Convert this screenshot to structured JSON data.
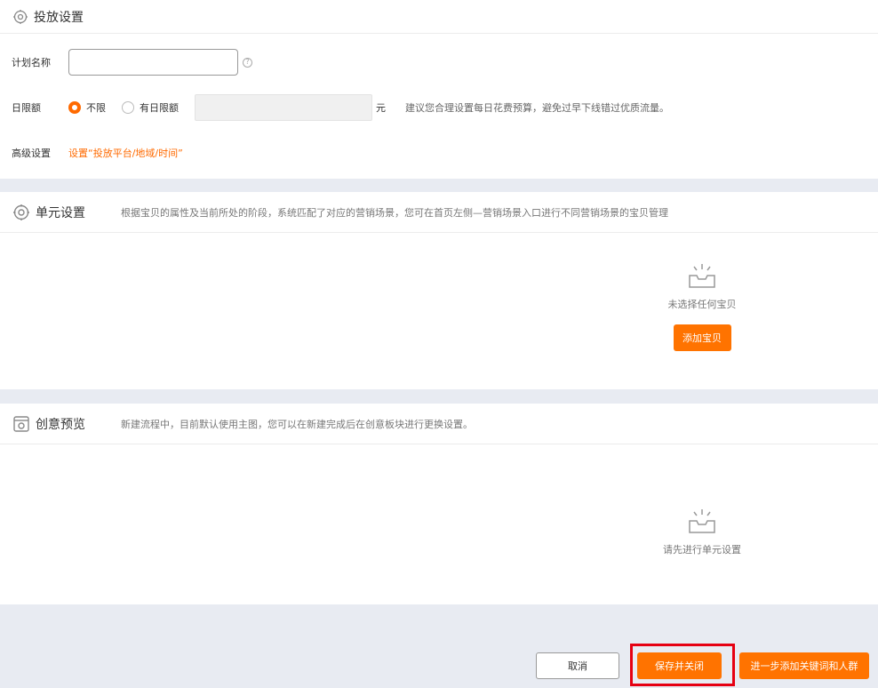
{
  "sections": {
    "delivery": {
      "title": "投放设置",
      "plan_name_label": "计划名称",
      "plan_name_value": "",
      "daily_limit_label": "日限额",
      "radio_unlimited": "不限",
      "radio_limited": "有日限额",
      "unit": "元",
      "budget_hint": "建议您合理设置每日花费预算，避免过早下线错过优质流量。",
      "advanced_label": "高级设置",
      "advanced_link": "设置“投放平台/地域/时间”"
    },
    "unit": {
      "title": "单元设置",
      "desc": "根据宝贝的属性及当前所处的阶段，系统匹配了对应的营销场景，您可在首页左侧—营销场景入口进行不同营销场景的宝贝管理",
      "empty_text": "未选择任何宝贝",
      "add_button": "添加宝贝"
    },
    "creative": {
      "title": "创意预览",
      "desc": "新建流程中，目前默认使用主图，您可以在新建完成后在创意板块进行更换设置。",
      "empty_text": "请先进行单元设置"
    }
  },
  "footer": {
    "cancel": "取消",
    "save_close": "保存并关闭",
    "next_step": "进一步添加关键词和人群"
  },
  "colors": {
    "accent": "#ff7300",
    "highlight": "#e60012"
  }
}
